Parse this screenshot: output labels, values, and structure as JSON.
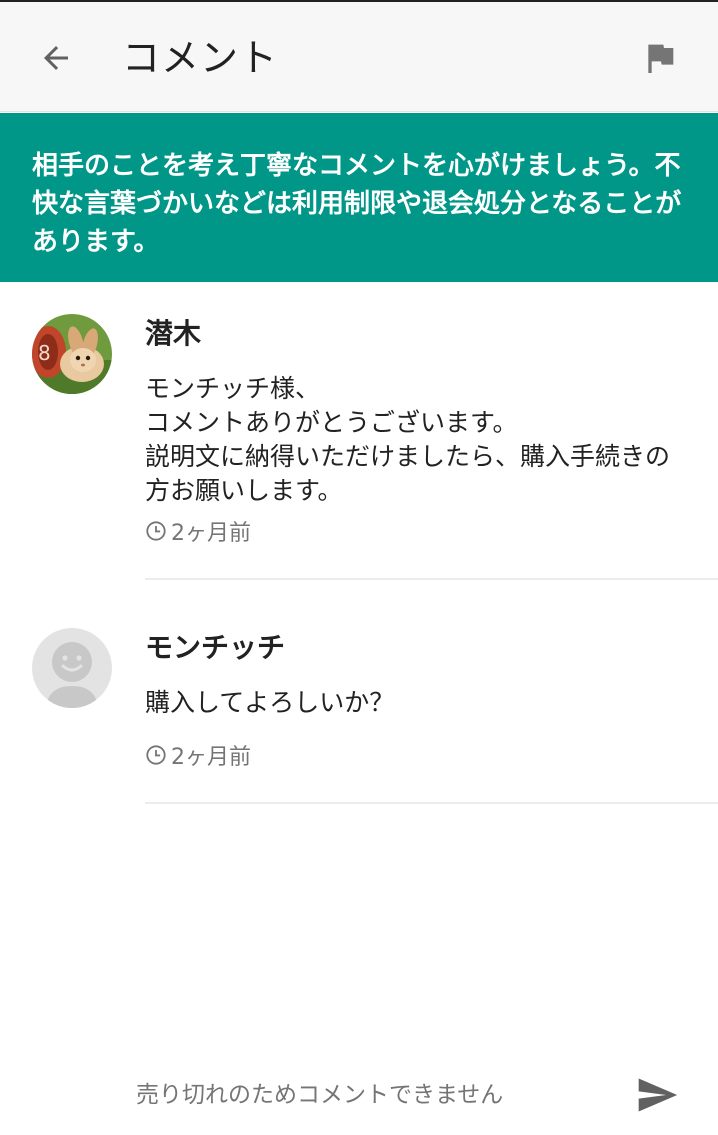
{
  "app_bar": {
    "title": "コメント",
    "back_icon": "arrow-back-icon",
    "report_icon": "flag-icon"
  },
  "notice": {
    "text": "相手のことを考え丁寧なコメントを心がけましょう。不快な言葉づかいなどは利用制限や退会処分となることがあります。",
    "background_color": "#009688"
  },
  "comments": [
    {
      "author": "潜木",
      "body": "モンチッチ様、\nコメントありがとうございます。\n説明文に納得いただけましたら、購入手続きの方お願いします。",
      "time": "2ヶ月前",
      "avatar": "rabbit-photo"
    },
    {
      "author": "モンチッチ",
      "body": "購入してよろしいか？",
      "time": "2ヶ月前",
      "avatar": "default-user-avatar"
    }
  ],
  "footer": {
    "placeholder": "売り切れのためコメントできません",
    "send_icon": "send-icon"
  }
}
